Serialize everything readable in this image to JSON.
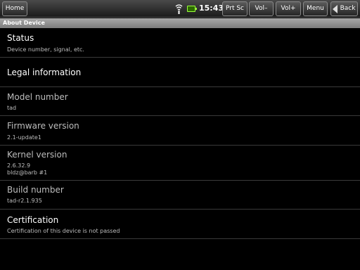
{
  "topbar": {
    "home_label": "Home",
    "time": "15:43",
    "prtsc_label": "Prt Sc",
    "voldown_label": "Vol–",
    "volup_label": "Vol+",
    "menu_label": "Menu",
    "back_label": "Back",
    "icons": {
      "wifi": "wifi-icon",
      "battery": "battery-charging-icon",
      "back": "back-arrow-icon"
    }
  },
  "header": {
    "title": "About Device"
  },
  "items": {
    "status": {
      "title": "Status",
      "subtitle": "Device number, signal, etc."
    },
    "legal": {
      "title": "Legal information"
    },
    "model": {
      "title": "Model number",
      "value": "tad"
    },
    "firmware": {
      "title": "Firmware version",
      "value": "2.1-update1"
    },
    "kernel": {
      "title": "Kernel version",
      "value_line1": "2.6.32.9",
      "value_line2": "bldz@barb #1"
    },
    "build": {
      "title": "Build number",
      "value": "tad-r2.1.935"
    },
    "certification": {
      "title": "Certification",
      "subtitle": "Certification of this device is not passed"
    }
  },
  "colors": {
    "background": "#000000",
    "header_bg": "#9a9a9a",
    "battery": "#9bff3c"
  }
}
